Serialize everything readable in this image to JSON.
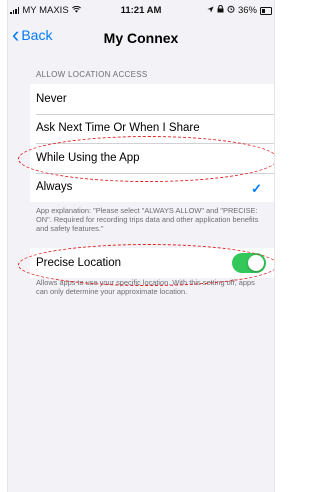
{
  "status_bar": {
    "carrier": "MY MAXIS",
    "time": "11:21 AM",
    "battery": "36%"
  },
  "nav": {
    "back_label": "Back",
    "title": "My Connex"
  },
  "location_access": {
    "header": "ALLOW LOCATION ACCESS",
    "options": [
      {
        "label": "Never",
        "selected": false
      },
      {
        "label": "Ask Next Time Or When I Share",
        "selected": false
      },
      {
        "label": "While Using the App",
        "selected": false
      },
      {
        "label": "Always",
        "selected": true
      }
    ],
    "footer": "App explanation: \"Please select \"ALWAYS ALLOW\" and \"PRECISE: ON\". Required for recording trips data and other application benefits and safety features.\""
  },
  "precise_location": {
    "label": "Precise Location",
    "enabled": true,
    "footer": "Allows apps to use your specific location. With this setting off, apps can only determine your approximate location."
  },
  "colors": {
    "accent": "#007aff",
    "toggle_on": "#34c759",
    "annotation": "#e02020",
    "background": "#f2f2f7"
  },
  "icons": {
    "signal": "signal-bars-icon",
    "wifi": "wifi-icon",
    "location": "location-arrow-icon",
    "lock": "orientation-lock-icon",
    "alarm": "alarm-icon",
    "battery": "battery-icon",
    "back": "chevron-left-icon",
    "check": "checkmark-icon"
  }
}
